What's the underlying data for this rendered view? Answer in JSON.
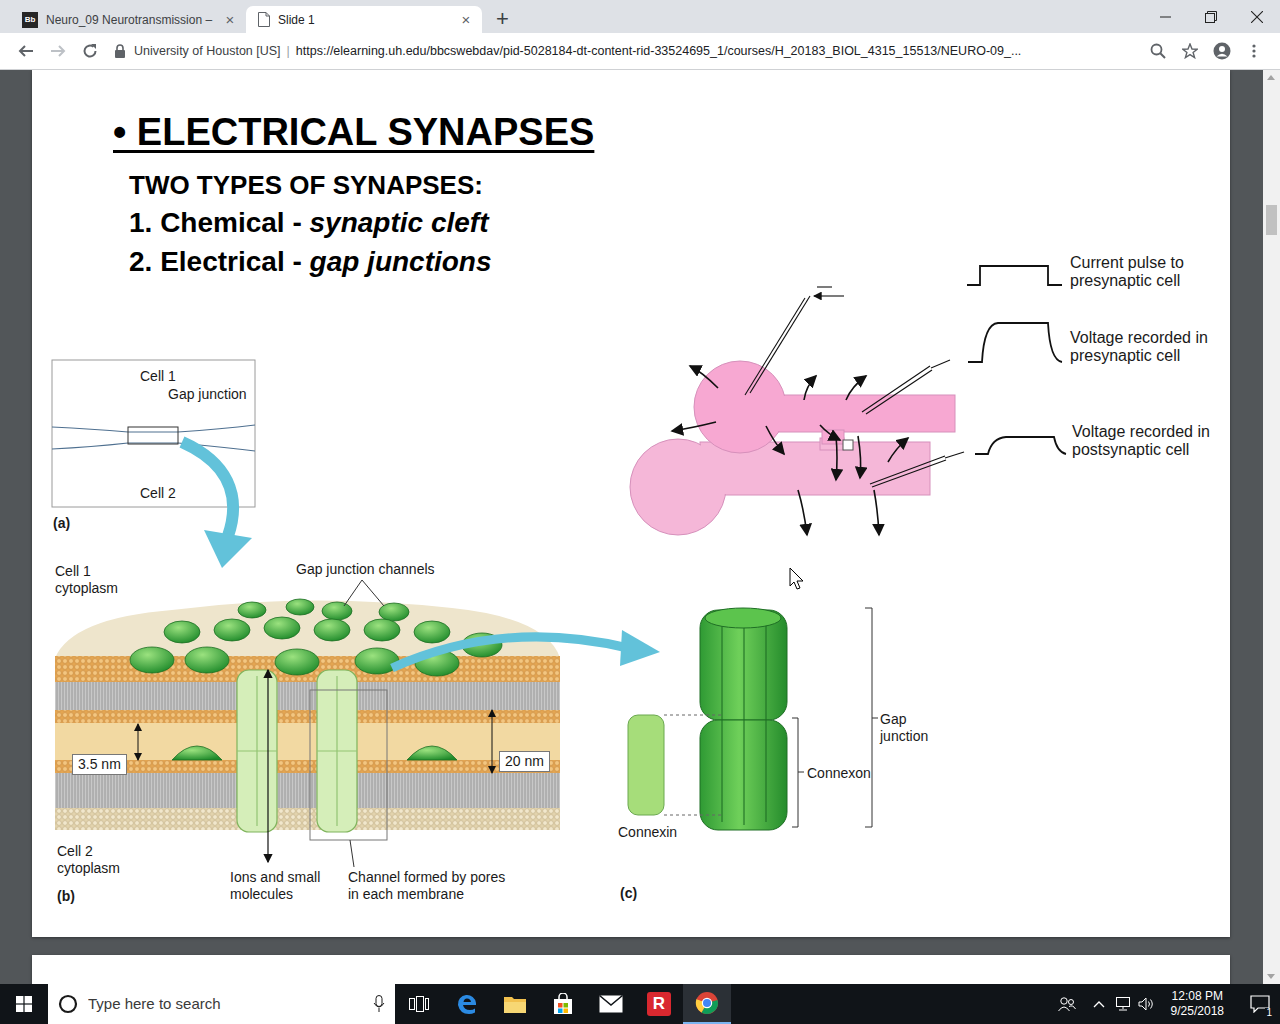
{
  "tabs": [
    {
      "favicon": "Bb",
      "label": "Neuro_09 Neurotransmission –",
      "close": "×",
      "selected": false
    },
    {
      "label": "Slide 1",
      "close": "×",
      "selected": true
    }
  ],
  "new_tab": "+",
  "address": {
    "site": "University of Houston [US]",
    "separator": "|",
    "url": "https://elearning.uh.edu/bbcswebdav/pid-5028184-dt-content-rid-33524695_1/courses/H_20183_BIOL_4315_15513/NEURO-09_..."
  },
  "slide": {
    "title": "• ELECTRICAL SYNAPSES",
    "subtitle": "TWO TYPES OF SYNAPSES:",
    "types": [
      {
        "lead": "1. Chemical - ",
        "term": "synaptic cleft"
      },
      {
        "lead": "2. Electrical - ",
        "term": "gap junctions"
      }
    ],
    "figure_a": {
      "cell1": "Cell 1",
      "junction": "Gap junction",
      "cell2": "Cell 2",
      "tag": "(a)"
    },
    "figure_b": {
      "cell1": "Cell 1 cytoplasm",
      "channels": "Gap junction channels",
      "gap_small": "3.5 nm",
      "gap_large": "20 nm",
      "cell2": "Cell 2 cytoplasm",
      "tag": "(b)",
      "ions": "Ions and small molecules",
      "pores": "Channel formed by pores in each membrane"
    },
    "figure_c": {
      "junction": "Gap junction",
      "connexon": "Connexon",
      "connexin": "Connexin",
      "tag": "(c)"
    },
    "recording": {
      "current": "Current pulse to presynaptic cell",
      "pre": "Voltage recorded in presynaptic cell",
      "post": "Voltage recorded in postsynaptic cell"
    }
  },
  "taskbar": {
    "search_placeholder": "Type here to search",
    "r_app": "R",
    "time": "12:08 PM",
    "date": "9/25/2018",
    "notifications": "1"
  }
}
